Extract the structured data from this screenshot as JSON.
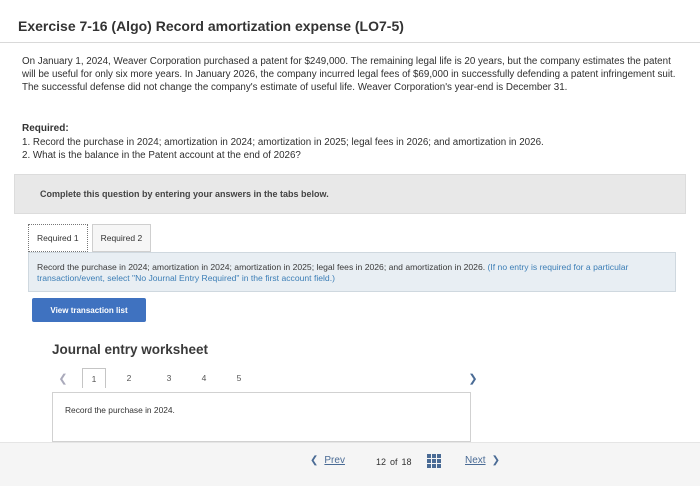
{
  "header": {
    "title": "Exercise 7-16 (Algo) Record amortization expense (LO7-5)"
  },
  "intro": {
    "text": "On January 1, 2024, Weaver Corporation purchased a patent for $249,000. The remaining legal life is 20 years, but the company estimates the patent will be useful for only six more years. In January 2026, the company incurred legal fees of $69,000 in successfully defending a patent infringement suit. The successful defense did not change the company's estimate of useful life. Weaver Corporation's year-end is December 31."
  },
  "required": {
    "heading": "Required:",
    "items": [
      "1. Record the purchase in 2024; amortization in 2024; amortization in 2025; legal fees in 2026; and amortization in 2026.",
      "2. What is the balance in the Patent account at the end of 2026?"
    ]
  },
  "complete_panel": {
    "text": "Complete this question by entering your answers in the tabs below."
  },
  "tabs": [
    {
      "label": "Required 1"
    },
    {
      "label": "Required 2"
    }
  ],
  "tab_panel": {
    "instruction": "Record the purchase in 2024; amortization in 2024; amortization in 2025; legal fees in 2026; and amortization in 2026.",
    "note": "(If no entry is required for a particular transaction/event, select \"No Journal Entry Required\" in the first account field.)"
  },
  "view_button": {
    "label": "View transaction list"
  },
  "worksheet": {
    "title": "Journal entry worksheet",
    "pages": [
      "1",
      "2",
      "3",
      "4",
      "5"
    ],
    "prev_icon": "chevron-left-icon",
    "next_icon": "chevron-right-icon",
    "box_text": "Record the purchase in 2024."
  },
  "footer": {
    "prev_label": "Prev",
    "next_label": "Next",
    "current": "12",
    "of_label": "of",
    "total": "18",
    "grid_icon": "grid-icon",
    "accent_color": "#4a6b95"
  },
  "colors": {
    "button_bg": "#3f72c0",
    "panel_bg": "#e8e8e8",
    "tab_panel_bg": "#e8eef3",
    "note_color": "#3c7eb6"
  }
}
